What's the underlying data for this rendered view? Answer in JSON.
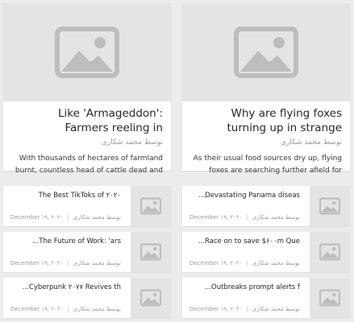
{
  "featured": [
    {
      "title": "Why are flying foxes turning up in strange places?",
      "author": "توسط محمد شکاری",
      "excerpt": "As their usual food sources dry up, flying foxes are searching further afield for shelt..."
    },
    {
      "title": "Like 'Armageddon': Farmers reeling in aftermath of...",
      "author": "توسط محمد شکاری",
      "excerpt": "With thousands of hectares of farmland burnt, countless head of cattle dead and tonnes..."
    }
  ],
  "list_right": [
    {
      "title": "Devastating Panama diseas...",
      "author": "توسط محمد شکاری",
      "date": "December ۱۹, ۲۰۲۰"
    },
    {
      "title": "Race on to save $۶۰۰m Que...",
      "author": "توسط محمد شکاری",
      "date": "December ۱۹, ۲۰۲۰"
    },
    {
      "title": "Outbreaks prompt alerts f...",
      "author": "توسط محمد شکاری",
      "date": "December ۱۹, ۲۰۲۰"
    }
  ],
  "list_left": [
    {
      "title": "The Best TikToks of ۲۰۲۰",
      "author": "توسط محمد شکاری",
      "date": "December ۱۹, ۲۰۲۰"
    },
    {
      "title": "The Future of Work: 'ars...",
      "author": "توسط محمد شکاری",
      "date": "December ۱۹, ۲۰۲۰"
    },
    {
      "title": "Cyberpunk ۲۰۷۷ Revives th...",
      "author": "توسط محمد شکاری",
      "date": "December ۱۹, ۲۰۲۰"
    }
  ],
  "icons": {
    "placeholder": "image-placeholder-icon"
  },
  "colors": {
    "background": "#ececec",
    "placeholder_bg": "#e4e4e4",
    "placeholder_icon": "#bdbdbd"
  }
}
